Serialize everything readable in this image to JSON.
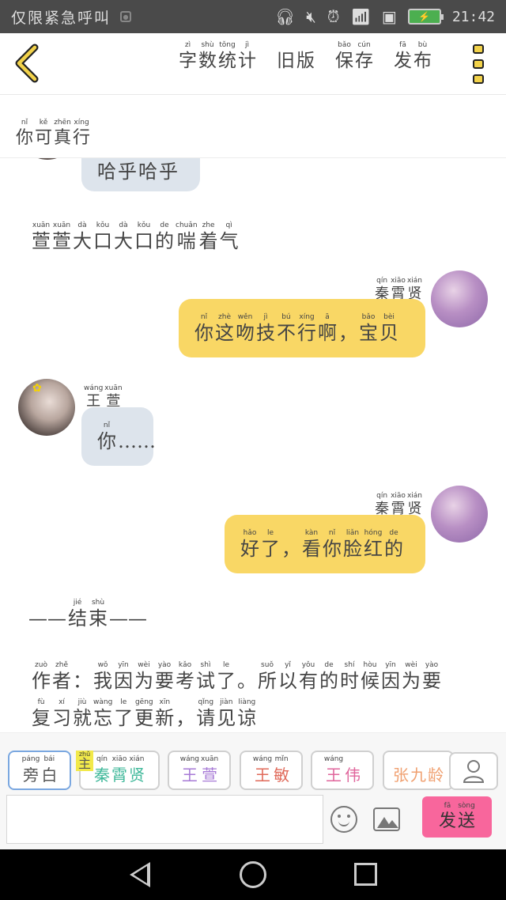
{
  "status_bar": {
    "notification_text": "仅限紧急呼叫",
    "time": "21:42"
  },
  "top_bar": {
    "actions": [
      {
        "name": "word-count",
        "chars": [
          {
            "py": "zì",
            "hz": "字"
          },
          {
            "py": "shù",
            "hz": "数"
          },
          {
            "py": "tǒng",
            "hz": "统"
          },
          {
            "py": "jì",
            "hz": "计"
          }
        ]
      },
      {
        "name": "old-version",
        "chars": [
          {
            "py": "",
            "hz": "旧"
          },
          {
            "py": "",
            "hz": "版"
          }
        ]
      },
      {
        "name": "save",
        "chars": [
          {
            "py": "bǎo",
            "hz": "保"
          },
          {
            "py": "cún",
            "hz": "存"
          }
        ]
      },
      {
        "name": "publish",
        "chars": [
          {
            "py": "fā",
            "hz": "发"
          },
          {
            "py": "bù",
            "hz": "布"
          }
        ]
      }
    ]
  },
  "subtitle": [
    {
      "py": "nǐ",
      "hz": "你"
    },
    {
      "py": "kě",
      "hz": "可"
    },
    {
      "py": "zhēn",
      "hz": "真"
    },
    {
      "py": "xíng",
      "hz": "行"
    }
  ],
  "chat": {
    "partial_bubble": [
      {
        "py": "",
        "hz": "哈"
      },
      {
        "py": "",
        "hz": "乎"
      },
      {
        "py": "",
        "hz": "哈"
      },
      {
        "py": "",
        "hz": "乎"
      }
    ],
    "narration_1": [
      {
        "py": "xuān",
        "hz": "萱"
      },
      {
        "py": "xuān",
        "hz": "萱"
      },
      {
        "py": "dà",
        "hz": "大"
      },
      {
        "py": "kǒu",
        "hz": "口"
      },
      {
        "py": "dà",
        "hz": "大"
      },
      {
        "py": "kǒu",
        "hz": "口"
      },
      {
        "py": "de",
        "hz": "的"
      },
      {
        "py": "chuǎn",
        "hz": "喘"
      },
      {
        "py": "zhe",
        "hz": "着"
      },
      {
        "py": "qì",
        "hz": "气"
      }
    ],
    "name_qin": [
      {
        "py": "qín",
        "hz": "秦"
      },
      {
        "py": "xiāo",
        "hz": "霄"
      },
      {
        "py": "xián",
        "hz": "贤"
      }
    ],
    "msg_1": [
      {
        "py": "nǐ",
        "hz": "你"
      },
      {
        "py": "zhè",
        "hz": "这"
      },
      {
        "py": "wěn",
        "hz": "吻"
      },
      {
        "py": "jì",
        "hz": "技"
      },
      {
        "py": "bú",
        "hz": "不"
      },
      {
        "py": "xíng",
        "hz": "行"
      },
      {
        "py": "ā",
        "hz": "啊"
      },
      {
        "py": "",
        "hz": "，"
      },
      {
        "py": "bǎo",
        "hz": "宝"
      },
      {
        "py": "bèi",
        "hz": "贝"
      }
    ],
    "name_wang": [
      {
        "py": "wáng",
        "hz": "王"
      },
      {
        "py": "xuān",
        "hz": "萱"
      }
    ],
    "msg_2": [
      {
        "py": "nǐ",
        "hz": "你"
      },
      {
        "py": "",
        "hz": "……"
      }
    ],
    "msg_3": [
      {
        "py": "hǎo",
        "hz": "好"
      },
      {
        "py": "le",
        "hz": "了"
      },
      {
        "py": "",
        "hz": "，"
      },
      {
        "py": "kàn",
        "hz": "看"
      },
      {
        "py": "nǐ",
        "hz": "你"
      },
      {
        "py": "liǎn",
        "hz": "脸"
      },
      {
        "py": "hóng",
        "hz": "红"
      },
      {
        "py": "de",
        "hz": "的"
      }
    ],
    "ending": [
      {
        "py": "",
        "hz": "——"
      },
      {
        "py": "jié",
        "hz": "结"
      },
      {
        "py": "shù",
        "hz": "束"
      },
      {
        "py": "",
        "hz": "——"
      }
    ],
    "author_line_1": [
      {
        "py": "zuò",
        "hz": "作"
      },
      {
        "py": "zhě",
        "hz": "者"
      },
      {
        "py": "",
        "hz": "："
      },
      {
        "py": "wǒ",
        "hz": "我"
      },
      {
        "py": "yīn",
        "hz": "因"
      },
      {
        "py": "wèi",
        "hz": "为"
      },
      {
        "py": "yào",
        "hz": "要"
      },
      {
        "py": "kǎo",
        "hz": "考"
      },
      {
        "py": "shì",
        "hz": "试"
      },
      {
        "py": "le",
        "hz": "了"
      },
      {
        "py": "",
        "hz": "。"
      },
      {
        "py": "suǒ",
        "hz": "所"
      },
      {
        "py": "yǐ",
        "hz": "以"
      },
      {
        "py": "yǒu",
        "hz": "有"
      },
      {
        "py": "de",
        "hz": "的"
      },
      {
        "py": "shí",
        "hz": "时"
      },
      {
        "py": "hòu",
        "hz": "候"
      },
      {
        "py": "yīn",
        "hz": "因"
      },
      {
        "py": "wèi",
        "hz": "为"
      },
      {
        "py": "yào",
        "hz": "要"
      }
    ],
    "author_line_2": [
      {
        "py": "fù",
        "hz": "复"
      },
      {
        "py": "xí",
        "hz": "习"
      },
      {
        "py": "jiù",
        "hz": "就"
      },
      {
        "py": "wàng",
        "hz": "忘"
      },
      {
        "py": "le",
        "hz": "了"
      },
      {
        "py": "gēng",
        "hz": "更"
      },
      {
        "py": "xīn",
        "hz": "新"
      },
      {
        "py": "",
        "hz": "，"
      },
      {
        "py": "qǐng",
        "hz": "请"
      },
      {
        "py": "jiàn",
        "hz": "见"
      },
      {
        "py": "liàng",
        "hz": "谅"
      }
    ]
  },
  "bottom": {
    "main_badge": {
      "py": "zhǔ",
      "hz": "主"
    },
    "chips": [
      {
        "chars": [
          {
            "py": "páng",
            "hz": "旁"
          },
          {
            "py": "bái",
            "hz": "白"
          }
        ],
        "color": "#555555",
        "selected": true
      },
      {
        "chars": [
          {
            "py": "qín",
            "hz": "秦"
          },
          {
            "py": "xiāo",
            "hz": "霄"
          },
          {
            "py": "xián",
            "hz": "贤"
          }
        ],
        "color": "#3fb89a"
      },
      {
        "chars": [
          {
            "py": "wáng",
            "hz": "王"
          },
          {
            "py": "xuān",
            "hz": "萱"
          }
        ],
        "color": "#a77ad6"
      },
      {
        "chars": [
          {
            "py": "wáng",
            "hz": "王"
          },
          {
            "py": "mǐn",
            "hz": "敏"
          }
        ],
        "color": "#e06a5a"
      },
      {
        "chars": [
          {
            "py": "wáng",
            "hz": "王"
          },
          {
            "py": "",
            "hz": "伟"
          }
        ],
        "color": "#e0669c"
      },
      {
        "chars": [
          {
            "py": "",
            "hz": "张"
          },
          {
            "py": "",
            "hz": "九"
          },
          {
            "py": "",
            "hz": "龄"
          }
        ],
        "color": "#f0a070"
      }
    ],
    "send": [
      {
        "py": "fā",
        "hz": "发"
      },
      {
        "py": "sòng",
        "hz": "送"
      }
    ]
  },
  "colors": {
    "accent": "#f9d765",
    "left_bubble": "#dde4ec",
    "send": "#f8669c"
  }
}
